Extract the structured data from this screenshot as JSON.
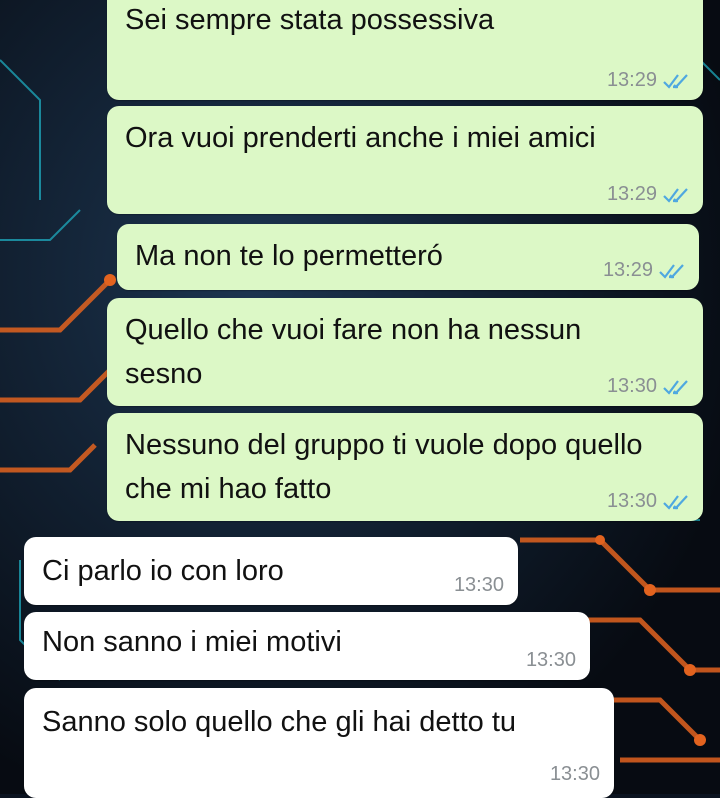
{
  "chat": {
    "colors": {
      "outgoing_bubble": "#dcf8c6",
      "incoming_bubble": "#ffffff",
      "read_ticks": "#4fa8e0",
      "timestamp": "#8a8f93"
    },
    "wallpaper": "dark circuit-board pattern with orange and teal traces",
    "messages": [
      {
        "direction": "outgoing",
        "text": "Sei sempre stata possessiva",
        "time": "13:29",
        "status": "read"
      },
      {
        "direction": "outgoing",
        "text": "Ora vuoi prenderti anche i miei amici",
        "time": "13:29",
        "status": "read"
      },
      {
        "direction": "outgoing",
        "text": "Ma non te lo permetteró",
        "time": "13:29",
        "status": "read"
      },
      {
        "direction": "outgoing",
        "text": "Quello che vuoi fare non ha nessun sesno",
        "time": "13:30",
        "status": "read"
      },
      {
        "direction": "outgoing",
        "text": "Nessuno del gruppo ti vuole dopo quello che mi hao fatto",
        "time": "13:30",
        "status": "read"
      },
      {
        "direction": "incoming",
        "text": "Ci parlo io con loro",
        "time": "13:30"
      },
      {
        "direction": "incoming",
        "text": "Non sanno i miei motivi",
        "time": "13:30"
      },
      {
        "direction": "incoming",
        "text": "Sanno solo quello che gli hai detto tu",
        "time": "13:30"
      }
    ]
  }
}
